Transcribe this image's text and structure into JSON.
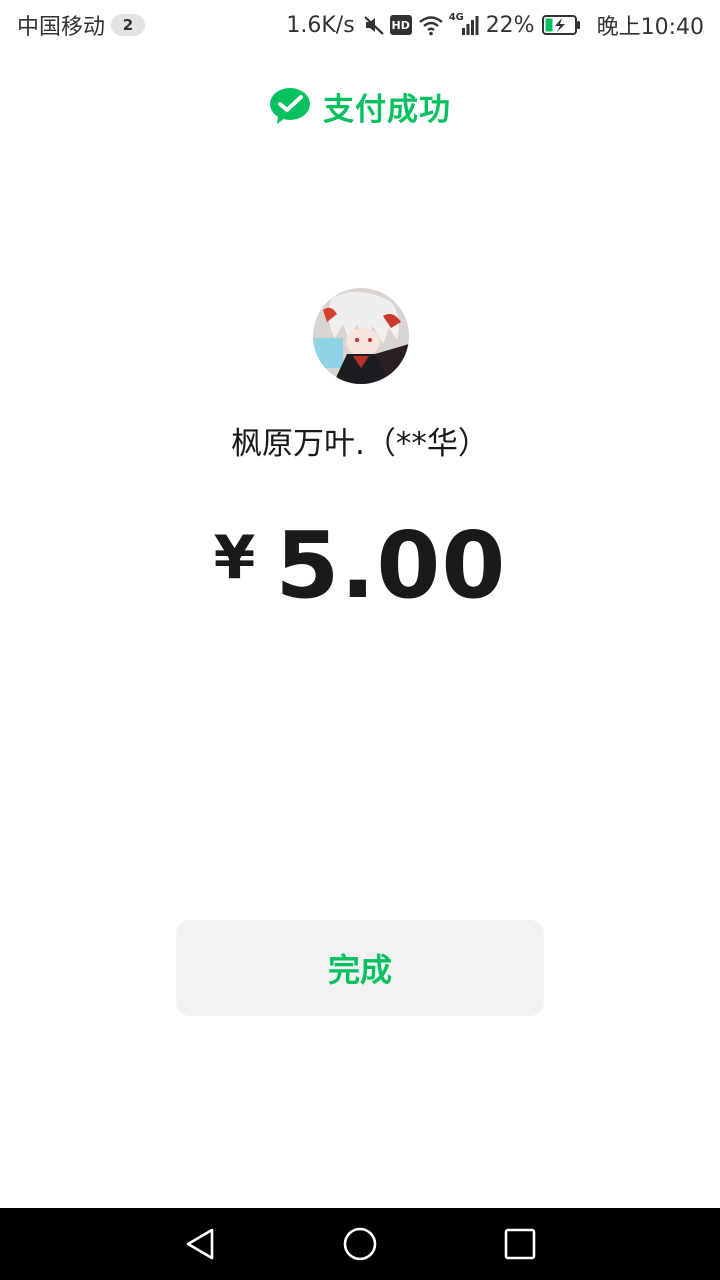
{
  "status_bar": {
    "carrier": "中国移动",
    "sim_slot": "2",
    "net_speed": "1.6K/s",
    "hd_label": "HD",
    "network_type": "4G",
    "battery_percent": "22%",
    "time": "晚上10:40",
    "icons": [
      "mute-icon",
      "hd-icon",
      "wifi-icon",
      "cellular-signal-icon",
      "battery-charging-icon"
    ]
  },
  "header": {
    "icon": "wechat-pay-icon",
    "title": "支付成功"
  },
  "payee": {
    "avatar": "avatar",
    "name": "枫原万叶.（**华）"
  },
  "payment": {
    "currency_symbol": "¥",
    "amount": "5.00"
  },
  "actions": {
    "done_label": "完成"
  },
  "nav_bar": {
    "buttons": [
      "back-triangle-icon",
      "home-circle-icon",
      "recents-square-icon"
    ]
  },
  "colors": {
    "accent": "#07c160",
    "text": "#1a1a1a",
    "button_bg": "#f2f2f2",
    "nav_bg": "#000000"
  }
}
